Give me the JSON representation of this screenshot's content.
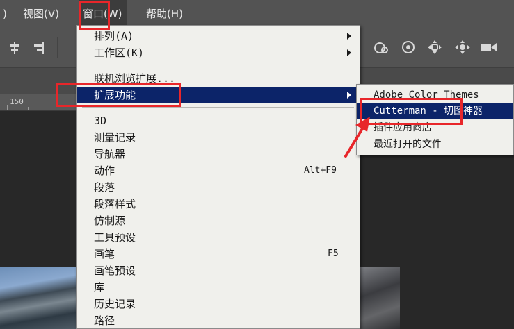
{
  "menubar": {
    "items": [
      {
        "label": ")"
      },
      {
        "label": "视图(V)"
      },
      {
        "label": "窗口(W)"
      },
      {
        "label": "帮助(H)"
      }
    ]
  },
  "window_menu": {
    "items": [
      {
        "label": "排列(A)",
        "shortcut": "",
        "submenu": true
      },
      {
        "label": "工作区(K)",
        "shortcut": "",
        "submenu": true
      },
      {
        "label": "联机浏览扩展...",
        "shortcut": "",
        "submenu": false
      },
      {
        "label": "扩展功能",
        "shortcut": "",
        "submenu": true,
        "highlighted": true
      },
      {
        "label": "3D",
        "shortcut": ""
      },
      {
        "label": "测量记录",
        "shortcut": ""
      },
      {
        "label": "导航器",
        "shortcut": ""
      },
      {
        "label": "动作",
        "shortcut": "Alt+F9"
      },
      {
        "label": "段落",
        "shortcut": ""
      },
      {
        "label": "段落样式",
        "shortcut": ""
      },
      {
        "label": "仿制源",
        "shortcut": ""
      },
      {
        "label": "工具预设",
        "shortcut": ""
      },
      {
        "label": "画笔",
        "shortcut": "F5"
      },
      {
        "label": "画笔预设",
        "shortcut": ""
      },
      {
        "label": "库",
        "shortcut": ""
      },
      {
        "label": "历史记录",
        "shortcut": ""
      },
      {
        "label": "路径",
        "shortcut": ""
      }
    ]
  },
  "extensions_submenu": {
    "items": [
      {
        "label": "Adobe Color Themes"
      },
      {
        "label": "Cutterman - 切图神器",
        "highlighted": true
      },
      {
        "label": "插件应用商店"
      },
      {
        "label": "最近打开的文件"
      }
    ]
  },
  "ruler": {
    "label": "150"
  },
  "toolbar": {
    "icons": [
      "align-center-icon",
      "align-right-icon",
      "3d-orbit-icon",
      "3d-roll-icon",
      "3d-pan-icon",
      "3d-slide-icon",
      "3d-camera-icon"
    ]
  },
  "colors": {
    "menu_highlight": "#0c2469",
    "annotation_red": "#e8262a",
    "menu_background": "#f0f0ec",
    "ui_dark": "#535353"
  }
}
